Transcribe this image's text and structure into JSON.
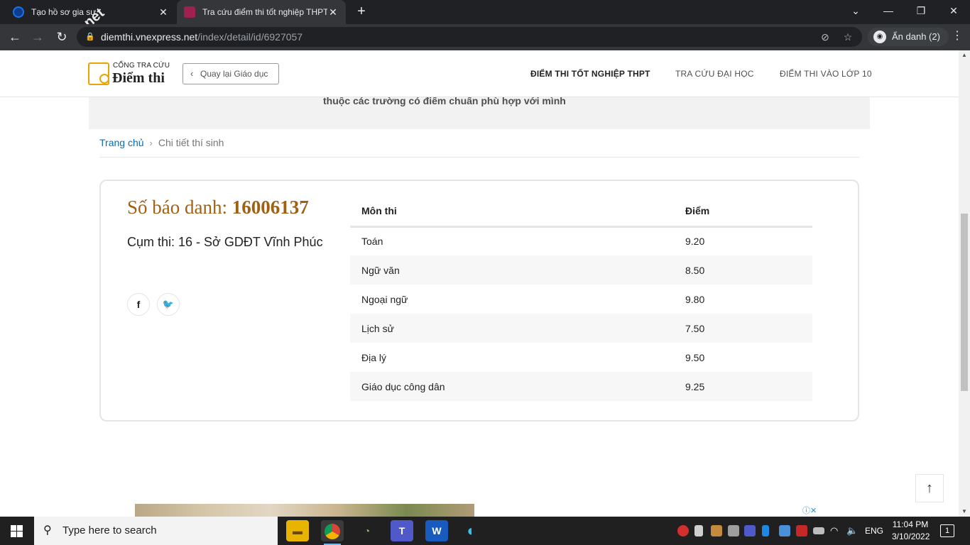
{
  "browser": {
    "tabs": [
      {
        "title": "Tạo hồ sơ gia sư",
        "favicon_color": "#1a73e8"
      },
      {
        "title": "Tra cứu điểm thi tốt nghiệp THPT",
        "favicon_color": "#9f224e"
      }
    ],
    "new_tab": "+",
    "window_controls": {
      "tab_search": "⌄",
      "minimize": "—",
      "restore": "❐",
      "close": "✕"
    },
    "watermark": "chau.net",
    "url_host": "diemthi.vnexpress.net",
    "url_path": "/index/detail/id/6927057",
    "profile_label": "Ẩn danh (2)"
  },
  "site": {
    "logo_top": "CỔNG TRA CỨU",
    "logo_main": "Điểm thi",
    "back_label": "Quay lại Giáo dục",
    "nav": [
      "ĐIỂM THI TỐT NGHIỆP THPT",
      "TRA CỨU ĐẠI HỌC",
      "ĐIỂM THI VÀO LỚP 10"
    ],
    "promo_text": "thuộc các trường có điểm chuẩn phù hợp với mình"
  },
  "breadcrumb": {
    "home": "Trang chủ",
    "current": "Chi tiết thí sinh"
  },
  "result": {
    "sbd_label": "Số báo danh: ",
    "sbd_value": "16006137",
    "cluster": "Cụm thi: 16 - Sở GDĐT Vĩnh Phúc",
    "table_headers": [
      "Môn thi",
      "Điểm"
    ],
    "rows": [
      {
        "subject": "Toán",
        "score": "9.20"
      },
      {
        "subject": "Ngữ văn",
        "score": "8.50"
      },
      {
        "subject": "Ngoại ngữ",
        "score": "9.80"
      },
      {
        "subject": "Lịch sử",
        "score": "7.50"
      },
      {
        "subject": "Địa lý",
        "score": "9.50"
      },
      {
        "subject": "Giáo dục công dân",
        "score": "9.25"
      }
    ]
  },
  "taskbar": {
    "search_placeholder": "Type here to search",
    "language": "ENG",
    "time": "11:04 PM",
    "date": "3/10/2022",
    "notification_count": "1"
  },
  "colors": {
    "accent": "#9f6113",
    "link": "#076db6",
    "brand_yellow": "#e8a400"
  }
}
